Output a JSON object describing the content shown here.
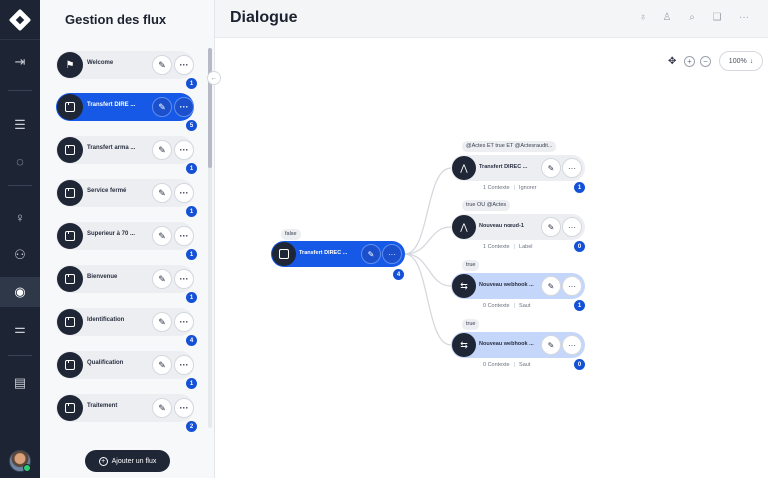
{
  "header": {
    "title": "Dialogue"
  },
  "panel": {
    "title": "Gestion des flux",
    "add_button": "Ajouter un flux",
    "items": [
      {
        "label": "Welcome",
        "count": "1",
        "icon": "flag-icon"
      },
      {
        "label": "Transfert DIRE ...",
        "count": "5",
        "icon": "folder-icon",
        "active": true
      },
      {
        "label": "Transfert arma ...",
        "count": "1",
        "icon": "folder-icon"
      },
      {
        "label": "Service fermé",
        "count": "1",
        "icon": "folder-icon"
      },
      {
        "label": "Superieur à 70 ...",
        "count": "1",
        "icon": "folder-icon"
      },
      {
        "label": "Bienvenue",
        "count": "1",
        "icon": "folder-icon"
      },
      {
        "label": "Identification",
        "count": "4",
        "icon": "folder-icon"
      },
      {
        "label": "Qualification",
        "count": "1",
        "icon": "folder-icon"
      },
      {
        "label": "Traitement",
        "count": "2",
        "icon": "folder-icon"
      }
    ]
  },
  "canvas": {
    "zoom": "100%",
    "main_node": {
      "label": "Transfert DIREC ...",
      "count": "4",
      "condition": "false"
    },
    "branches": [
      {
        "condition": "@Actes ET true ET @Actesraudit...",
        "label": "Transfert DIREC ...",
        "meta_a": "1 Contexte",
        "meta_b": "Ignorer",
        "count": "1",
        "icon": "transfer-icon"
      },
      {
        "condition": "true OU @Actes",
        "label": "Nouveau nœud-1",
        "meta_a": "1 Contexte",
        "meta_b": "Label",
        "count": "0",
        "icon": "transfer-icon"
      },
      {
        "condition": "true",
        "label": "Nouveau webhook ...",
        "meta_a": "0 Contexte",
        "meta_b": "Saut",
        "count": "1",
        "icon": "webhook-icon"
      },
      {
        "condition": "true",
        "label": "Nouveau webhook ...",
        "meta_a": "0 Contexte",
        "meta_b": "Saut",
        "count": "0",
        "icon": "webhook-icon"
      }
    ]
  },
  "colors": {
    "accent": "#1659e6",
    "dark": "#1f2636",
    "webhook_bg": "#c5d6fb",
    "badge": "#1551d6"
  }
}
